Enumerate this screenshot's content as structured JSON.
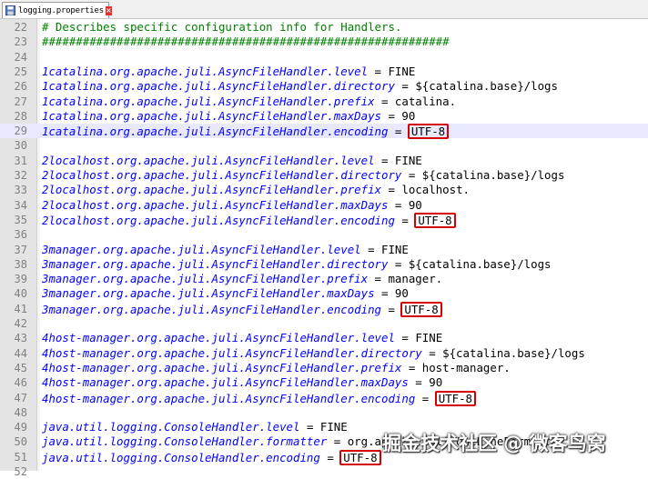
{
  "tab": {
    "filename": "logging.properties",
    "icon": "save-file-icon",
    "close_icon": "close-icon"
  },
  "colors": {
    "comment": "#008000",
    "key": "#0000ff",
    "highlight_box": "#d40000",
    "current_line": "#e8e8ff"
  },
  "current_line": 29,
  "lines": [
    {
      "n": "22",
      "type": "comment",
      "text": "# Describes specific configuration info for Handlers."
    },
    {
      "n": "23",
      "type": "comment",
      "text": "############################################################"
    },
    {
      "n": "24",
      "type": "blank"
    },
    {
      "n": "25",
      "type": "prop",
      "key": "1catalina.org.apache.juli.AsyncFileHandler.level",
      "value": "FINE"
    },
    {
      "n": "26",
      "type": "prop",
      "key": "1catalina.org.apache.juli.AsyncFileHandler.directory",
      "value": "${catalina.base}/logs"
    },
    {
      "n": "27",
      "type": "prop",
      "key": "1catalina.org.apache.juli.AsyncFileHandler.prefix",
      "value": "catalina."
    },
    {
      "n": "28",
      "type": "prop",
      "key": "1catalina.org.apache.juli.AsyncFileHandler.maxDays",
      "value": "90"
    },
    {
      "n": "29",
      "type": "prop",
      "key": "1catalina.org.apache.juli.AsyncFileHandler.encoding",
      "value": "UTF-8",
      "boxed": true
    },
    {
      "n": "30",
      "type": "blank"
    },
    {
      "n": "31",
      "type": "prop",
      "key": "2localhost.org.apache.juli.AsyncFileHandler.level",
      "value": "FINE"
    },
    {
      "n": "32",
      "type": "prop",
      "key": "2localhost.org.apache.juli.AsyncFileHandler.directory",
      "value": "${catalina.base}/logs"
    },
    {
      "n": "33",
      "type": "prop",
      "key": "2localhost.org.apache.juli.AsyncFileHandler.prefix",
      "value": "localhost."
    },
    {
      "n": "34",
      "type": "prop",
      "key": "2localhost.org.apache.juli.AsyncFileHandler.maxDays",
      "value": "90"
    },
    {
      "n": "35",
      "type": "prop",
      "key": "2localhost.org.apache.juli.AsyncFileHandler.encoding",
      "value": "UTF-8",
      "boxed": true
    },
    {
      "n": "36",
      "type": "blank"
    },
    {
      "n": "37",
      "type": "prop",
      "key": "3manager.org.apache.juli.AsyncFileHandler.level",
      "value": "FINE"
    },
    {
      "n": "38",
      "type": "prop",
      "key": "3manager.org.apache.juli.AsyncFileHandler.directory",
      "value": "${catalina.base}/logs"
    },
    {
      "n": "39",
      "type": "prop",
      "key": "3manager.org.apache.juli.AsyncFileHandler.prefix",
      "value": "manager."
    },
    {
      "n": "40",
      "type": "prop",
      "key": "3manager.org.apache.juli.AsyncFileHandler.maxDays",
      "value": "90"
    },
    {
      "n": "41",
      "type": "prop",
      "key": "3manager.org.apache.juli.AsyncFileHandler.encoding",
      "value": "UTF-8",
      "boxed": true
    },
    {
      "n": "42",
      "type": "blank"
    },
    {
      "n": "43",
      "type": "prop",
      "key": "4host-manager.org.apache.juli.AsyncFileHandler.level",
      "value": "FINE"
    },
    {
      "n": "44",
      "type": "prop",
      "key": "4host-manager.org.apache.juli.AsyncFileHandler.directory",
      "value": "${catalina.base}/logs"
    },
    {
      "n": "45",
      "type": "prop",
      "key": "4host-manager.org.apache.juli.AsyncFileHandler.prefix",
      "value": "host-manager."
    },
    {
      "n": "46",
      "type": "prop",
      "key": "4host-manager.org.apache.juli.AsyncFileHandler.maxDays",
      "value": "90"
    },
    {
      "n": "47",
      "type": "prop",
      "key": "4host-manager.org.apache.juli.AsyncFileHandler.encoding",
      "value": "UTF-8",
      "boxed": true
    },
    {
      "n": "48",
      "type": "blank"
    },
    {
      "n": "49",
      "type": "prop",
      "key": "java.util.logging.ConsoleHandler.level",
      "value": "FINE"
    },
    {
      "n": "50",
      "type": "prop",
      "key": "java.util.logging.ConsoleHandler.formatter",
      "value": "org.apache.juli.OneLineFormatter"
    },
    {
      "n": "51",
      "type": "prop",
      "key": "java.util.logging.ConsoleHandler.encoding",
      "value": "UTF-8",
      "boxed": true
    },
    {
      "n": "52",
      "type": "blank"
    }
  ],
  "watermark": "掘金技术社区 @ 微客鸟窝"
}
